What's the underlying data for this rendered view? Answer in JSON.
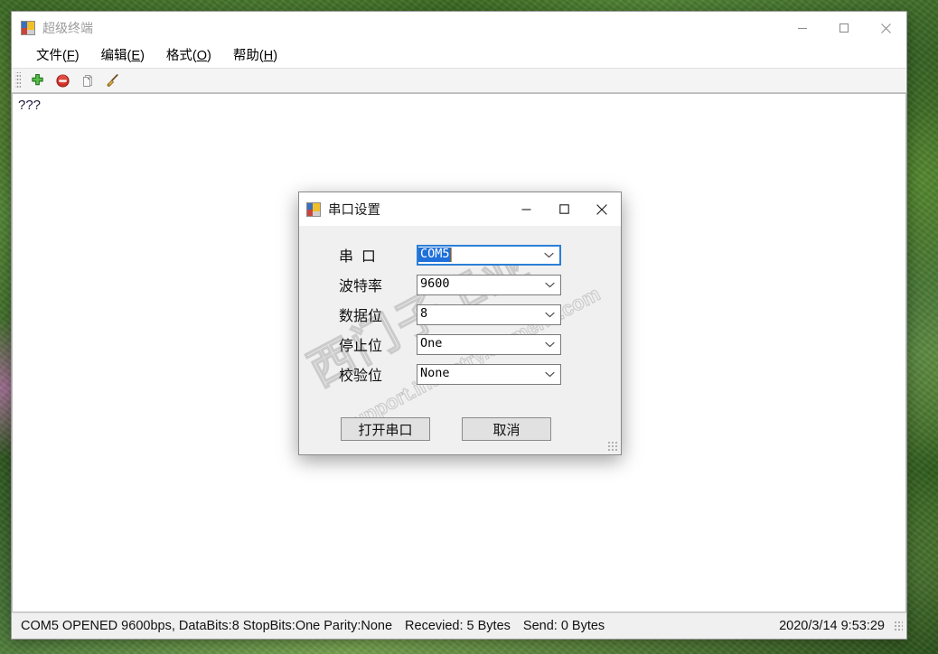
{
  "main_window": {
    "title": "超级终端",
    "icon": "app-window-icon",
    "menu": [
      {
        "text": "文件",
        "accel": "F"
      },
      {
        "text": "编辑",
        "accel": "E"
      },
      {
        "text": "格式",
        "accel": "O"
      },
      {
        "text": "帮助",
        "accel": "H"
      }
    ],
    "toolbar": [
      {
        "name": "add-connection-button",
        "icon": "green-plus-icon",
        "color": "#2e9b2e"
      },
      {
        "name": "stop-connection-button",
        "icon": "red-stop-icon",
        "color": "#cc2222"
      },
      {
        "name": "copy-button",
        "icon": "copy-pages-icon",
        "color": "#9a9a9a"
      },
      {
        "name": "clear-button",
        "icon": "broom-icon",
        "color": "#c8a24a"
      }
    ],
    "console_text": "???",
    "window_controls": {
      "minimize": "minimize-icon",
      "maximize": "maximize-icon",
      "close": "close-icon"
    },
    "statusbar": {
      "connection": "COM5 OPENED 9600bps, DataBits:8 StopBits:One Parity:None",
      "received": "Recevied: 5 Bytes",
      "sent": "Send: 0 Bytes",
      "timestamp": "2020/3/14 9:53:29"
    }
  },
  "dialog": {
    "title": "串口设置",
    "icon": "app-window-icon",
    "window_controls": {
      "minimize": "minimize-icon",
      "maximize": "maximize-icon",
      "close": "close-icon"
    },
    "fields": [
      {
        "label": "串  口",
        "value": "COM5",
        "name": "port",
        "focused": true
      },
      {
        "label": "波特率",
        "value": "9600",
        "name": "baud-rate",
        "focused": false
      },
      {
        "label": "数据位",
        "value": "8",
        "name": "data-bits",
        "focused": false
      },
      {
        "label": "停止位",
        "value": "One",
        "name": "stop-bits",
        "focused": false
      },
      {
        "label": "校验位",
        "value": "None",
        "name": "parity",
        "focused": false
      }
    ],
    "buttons": {
      "confirm": "打开串口",
      "cancel": "取消"
    },
    "watermark_cn": "西门子工业",
    "watermark_en": "support.industry.siemens.com"
  },
  "colors": {
    "accent": "#2b7fd6",
    "selection": "#1e6fd9",
    "window_bg": "#ffffff",
    "dialog_bg": "#f0f0f0",
    "statusbar_bg": "#f0f0f0"
  }
}
